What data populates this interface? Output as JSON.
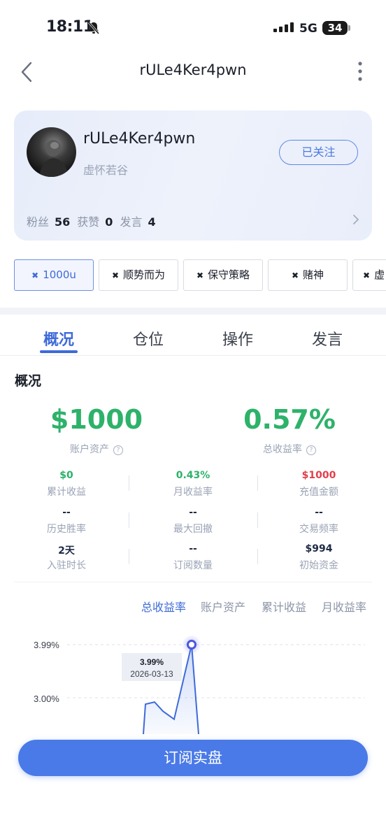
{
  "status_bar": {
    "time": "18:11",
    "network": "5G",
    "battery": "34"
  },
  "header": {
    "title": "rULe4Ker4pwn"
  },
  "profile": {
    "username": "rULe4Ker4pwn",
    "nickname": "虚怀若谷",
    "follow_label": "已关注",
    "stats": {
      "fans_label": "粉丝",
      "fans": "56",
      "likes_label": "获赞",
      "likes": "0",
      "posts_label": "发言",
      "posts": "4"
    }
  },
  "chips": [
    "1000u",
    "顺势而为",
    "保守策略",
    "赌神",
    "虚"
  ],
  "chip_icon": "✖",
  "tabs": [
    "概况",
    "仓位",
    "操作",
    "发言"
  ],
  "section_title": "概况",
  "summary": {
    "assets_value": "$1000",
    "assets_label": "账户资产",
    "total_return_value": "0.57%",
    "total_return_label": "总收益率",
    "help_glyph": "?"
  },
  "metrics": [
    {
      "value": "$0",
      "label": "累计收益"
    },
    {
      "value": "0.43%",
      "label": "月收益率"
    },
    {
      "value": "$1000",
      "label": "充值金额"
    },
    {
      "value": "--",
      "label": "历史胜率"
    },
    {
      "value": "--",
      "label": "最大回撤"
    },
    {
      "value": "--",
      "label": "交易频率"
    },
    {
      "value": "2天",
      "label": "入驻时长"
    },
    {
      "value": "--",
      "label": "订阅数量"
    },
    {
      "value": "$994",
      "label": "初始资金"
    }
  ],
  "chart_tabs": [
    "总收益率",
    "账户资产",
    "累计收益",
    "月收益率"
  ],
  "chart_data": {
    "type": "line",
    "series": [
      {
        "values": [
          2.88,
          2.92,
          2.75,
          2.6,
          3.99
        ]
      }
    ],
    "y_ticks": [
      "3.99%",
      "3.00%"
    ],
    "tooltip": {
      "value": "3.99%",
      "date": "2026-03-13"
    }
  },
  "subscribe_label": "订阅实盘",
  "colors": {
    "accent": "#3e6bd9",
    "positive": "#2db26a",
    "negative": "#e0404c",
    "button": "#4a7ae8"
  }
}
